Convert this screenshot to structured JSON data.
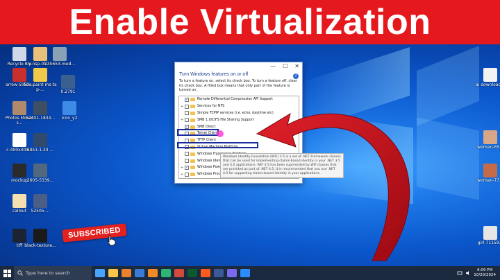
{
  "banner": {
    "title": "Enable Virtualization"
  },
  "desktop_left_icons": [
    {
      "label": "Recycle Bin",
      "color": "#cfd8e6"
    },
    {
      "label": "y-nsp-05-...",
      "color": "#e8c07a"
    },
    {
      "label": "235653-med...",
      "color": "#8aa0b6"
    },
    {
      "label": "arrow-5952...",
      "color": "#c9302c"
    },
    {
      "label": "line-paint ms-tap-...",
      "color": "#f0c84a"
    },
    {
      "label": "0.2791",
      "color": "#3b5f8f"
    },
    {
      "label": "Photos Movers...",
      "color": "#b08a6a"
    },
    {
      "label": "52401-1834...",
      "color": "#3e4e63"
    },
    {
      "label": "icon_y2",
      "color": "#3d8be5"
    },
    {
      "label": "c-400x400...",
      "color": "#ffffff"
    },
    {
      "label": "6051-1.33 ...",
      "color": "#2f4a6e"
    },
    {
      "label": "mockup",
      "color": "#2a2a2a"
    },
    {
      "label": "2605-5339...",
      "color": "#52687f"
    },
    {
      "label": "callout",
      "color": "#f5e0b0"
    },
    {
      "label": "52505-...",
      "color": "#4a5e86"
    },
    {
      "label": "tiff",
      "color": "#1c2433"
    },
    {
      "label": "black-texture...",
      "color": "#1a1a1a"
    }
  ],
  "desktop_right_icons": [
    {
      "label": "ai download...",
      "color": "#f2f2f2"
    },
    {
      "label": "woman-65...",
      "color": "#d9a587"
    },
    {
      "label": "woman-77...",
      "color": "#c66b4a"
    },
    {
      "label": "girl-71159...",
      "color": "#e6e6e6"
    }
  ],
  "dialog": {
    "window_controls": [
      "—",
      "☐",
      "✕"
    ],
    "heading": "Turn Windows features on or off",
    "help": "?",
    "description": "To turn a feature on, select its check box. To turn a feature off, clear its check box. A filled box means that only part of the feature is turned on.",
    "features": [
      {
        "label": "Remote Differential Compression API Support",
        "expand": "",
        "checked": true
      },
      {
        "label": "Services for NFS",
        "expand": "+",
        "checked": false
      },
      {
        "label": "Simple TCPIP services (i.e. echo, daytime etc)",
        "expand": "",
        "checked": false
      },
      {
        "label": "SMB 1.0/CIFS File Sharing Support",
        "expand": "+",
        "checked": false
      },
      {
        "label": "SMB Direct",
        "expand": "",
        "checked": true
      },
      {
        "label": "Telnet Client",
        "expand": "",
        "checked": false
      },
      {
        "label": "TFTP Client",
        "expand": "",
        "checked": false
      },
      {
        "label": "Virtual Machine Platform",
        "expand": "",
        "checked": false
      },
      {
        "label": "Windows Hypervisor Platform",
        "expand": "",
        "checked": false
      },
      {
        "label": "Windows Identity Foundation 3.5",
        "expand": "",
        "checked": false
      },
      {
        "label": "Windows PowerShell 2.0",
        "expand": "+",
        "checked": true
      },
      {
        "label": "Windows Process Activation Service",
        "expand": "+",
        "checked": false
      }
    ],
    "tooltip": "Windows Identity Foundation (WIF) 3.5 is a set of .NET Framework classes that can be used for implementing claims-based identity in your .NET 3.5 and 4.0 applications. WIF 3.5 has been superseded by WIF classes that are provided as part of .NET 4.5. It is recommended that you use .NET 4.5 for supporting claims-based identity in your applications."
  },
  "badge": {
    "subscribed": "SUBSCRIBED"
  },
  "taskbar": {
    "search_placeholder": "Type here to search",
    "apps": [
      "#4aa3ff",
      "#f6c54a",
      "#e9812d",
      "#3a7bd5",
      "#f08a24",
      "#2bb673",
      "#d54b3b",
      "#0b5a2e",
      "#ff5a1f",
      "#3b5998",
      "#7a6af0",
      "#2d8cff"
    ],
    "time": "6:09 PM",
    "date": "10/20/2024"
  },
  "colors": {
    "banner": "#e5191d",
    "arrow": "#c8101a",
    "highlight": "#1a2d9f"
  }
}
